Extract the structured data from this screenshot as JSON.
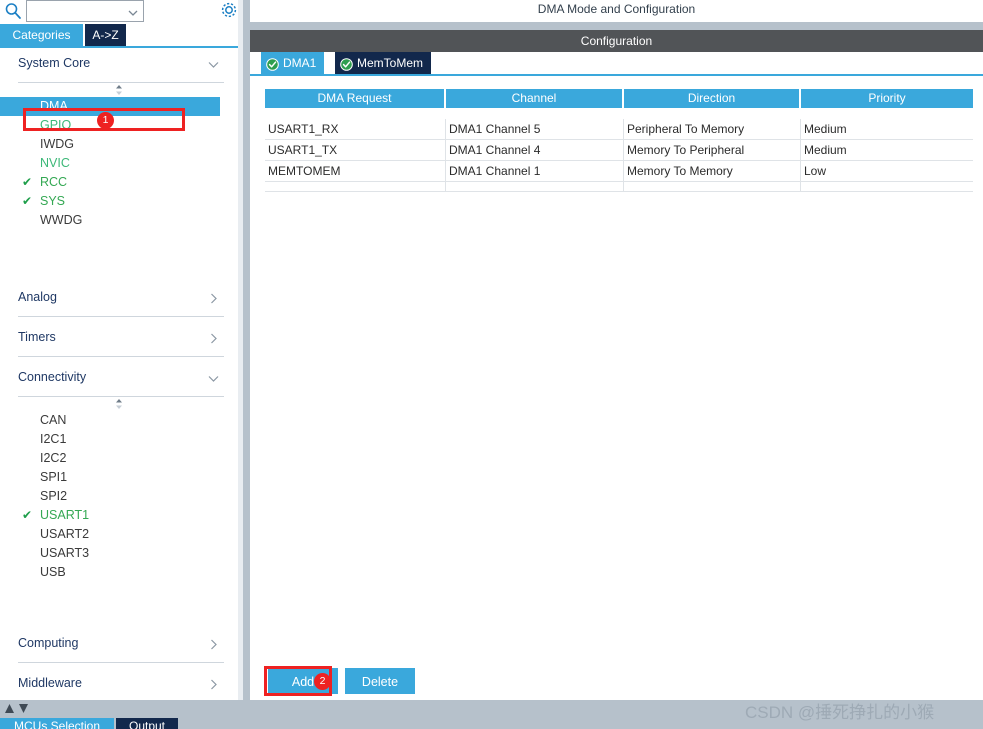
{
  "window": {
    "main_title": "DMA Mode and Configuration",
    "config_bar": "Configuration"
  },
  "colors": {
    "accent": "#3aa8dc",
    "dark_navy": "#12284c",
    "config_bar_gray": "#515457",
    "annotation_red": "#ee2222",
    "check_green": "#1e9e4a",
    "strip_gray": "#b6c1cb"
  },
  "sidebar": {
    "search": {
      "value": "",
      "placeholder": ""
    },
    "icons": {
      "search": "search-icon",
      "chevron": "chevron-down-icon",
      "gear": "gear-icon"
    },
    "tabs": [
      {
        "label": "Categories",
        "active": true
      },
      {
        "label": "A->Z",
        "active": false
      }
    ],
    "sections": [
      {
        "title": "System Core",
        "expanded": true,
        "items": [
          {
            "label": "DMA",
            "checked": false,
            "selected": true,
            "style": "sel"
          },
          {
            "label": "GPIO",
            "checked": false,
            "selected": false,
            "style": "c-green"
          },
          {
            "label": "IWDG",
            "checked": false,
            "selected": false,
            "style": "c-dark"
          },
          {
            "label": "NVIC",
            "checked": false,
            "selected": false,
            "style": "c-green"
          },
          {
            "label": "RCC",
            "checked": true,
            "selected": false,
            "style": "c-green2"
          },
          {
            "label": "SYS",
            "checked": true,
            "selected": false,
            "style": "c-green2"
          },
          {
            "label": "WWDG",
            "checked": false,
            "selected": false,
            "style": "c-dark"
          }
        ]
      },
      {
        "title": "Analog",
        "expanded": false,
        "items": []
      },
      {
        "title": "Timers",
        "expanded": false,
        "items": []
      },
      {
        "title": "Connectivity",
        "expanded": true,
        "items": [
          {
            "label": "CAN",
            "checked": false,
            "selected": false,
            "style": "c-dark"
          },
          {
            "label": "I2C1",
            "checked": false,
            "selected": false,
            "style": "c-dark"
          },
          {
            "label": "I2C2",
            "checked": false,
            "selected": false,
            "style": "c-dark"
          },
          {
            "label": "SPI1",
            "checked": false,
            "selected": false,
            "style": "c-dark"
          },
          {
            "label": "SPI2",
            "checked": false,
            "selected": false,
            "style": "c-dark"
          },
          {
            "label": "USART1",
            "checked": true,
            "selected": false,
            "style": "c-green2"
          },
          {
            "label": "USART2",
            "checked": false,
            "selected": false,
            "style": "c-dark"
          },
          {
            "label": "USART3",
            "checked": false,
            "selected": false,
            "style": "c-dark"
          },
          {
            "label": "USB",
            "checked": false,
            "selected": false,
            "style": "c-dark"
          }
        ]
      },
      {
        "title": "Computing",
        "expanded": false,
        "items": []
      },
      {
        "title": "Middleware",
        "expanded": false,
        "items": []
      }
    ]
  },
  "main": {
    "tabs": [
      {
        "label": "DMA1",
        "active": true,
        "icon": "check-circle-icon"
      },
      {
        "label": "MemToMem",
        "active": false,
        "icon": "check-circle-icon"
      }
    ],
    "table": {
      "columns": [
        "DMA Request",
        "Channel",
        "Direction",
        "Priority"
      ],
      "rows": [
        [
          "USART1_RX",
          "DMA1 Channel 5",
          "Peripheral To Memory",
          "Medium"
        ],
        [
          "USART1_TX",
          "DMA1 Channel 4",
          "Memory To Peripheral",
          "Medium"
        ],
        [
          "MEMTOMEM",
          "DMA1 Channel 1",
          "Memory To Memory",
          "Low"
        ]
      ]
    },
    "buttons": {
      "add": "Add",
      "delete": "Delete"
    }
  },
  "annotations": [
    {
      "number": "1",
      "target": "sidebar-item-dma"
    },
    {
      "number": "2",
      "target": "add-button"
    }
  ],
  "bottom": {
    "tabs": [
      {
        "label": "MCUs Selection",
        "active": true
      },
      {
        "label": "Output",
        "active": false
      }
    ]
  },
  "watermark": "CSDN @捶死挣扎的小猴"
}
